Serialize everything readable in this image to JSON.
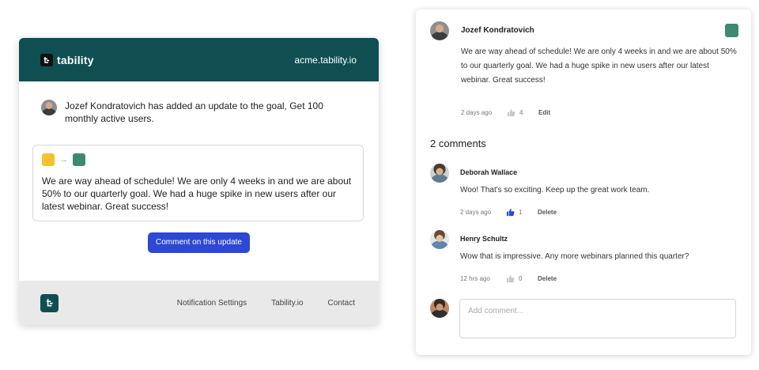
{
  "email": {
    "brand": "tability",
    "domain": "acme.tability.io",
    "update_text": "Jozef Kondratovich has added an update to the goal, Get 100 monthly active users.",
    "status_from_color": "#f4c12f",
    "status_to_color": "#3d8a74",
    "status_arrow": "→",
    "update_body": "We are way ahead of schedule! We are only 4 weeks in and we are about 50% to our quarterly goal. We had a huge spike in new users after our latest webinar. Great success!",
    "cta_label": "Comment on this update",
    "footer_links": [
      "Notification Settings",
      "Tability.io",
      "Contact"
    ],
    "header_color": "#0f4f52"
  },
  "panel": {
    "post": {
      "author": "Jozef Kondratovich",
      "status_color": "#3d8a74",
      "text": "We are way ahead of schedule! We are only 4 weeks in and we are about 50% to our quarterly goal. We had a huge spike in new users after our latest webinar. Great success!",
      "time": "2 days ago",
      "likes": "4",
      "action": "Edit"
    },
    "comments_title": "2 comments",
    "comments": [
      {
        "author": "Deborah Wallace",
        "text": "Woo! That's so exciting. Keep up the great work team.",
        "time": "2 days ago",
        "likes": "1",
        "liked": true,
        "action": "Delete"
      },
      {
        "author": "Henry Schultz",
        "text": "Wow that is impressive. Any more webinars planned this quarter?",
        "time": "12 hrs ago",
        "likes": "0",
        "liked": false,
        "action": "Delete"
      }
    ],
    "input_placeholder": "Add comment..."
  }
}
